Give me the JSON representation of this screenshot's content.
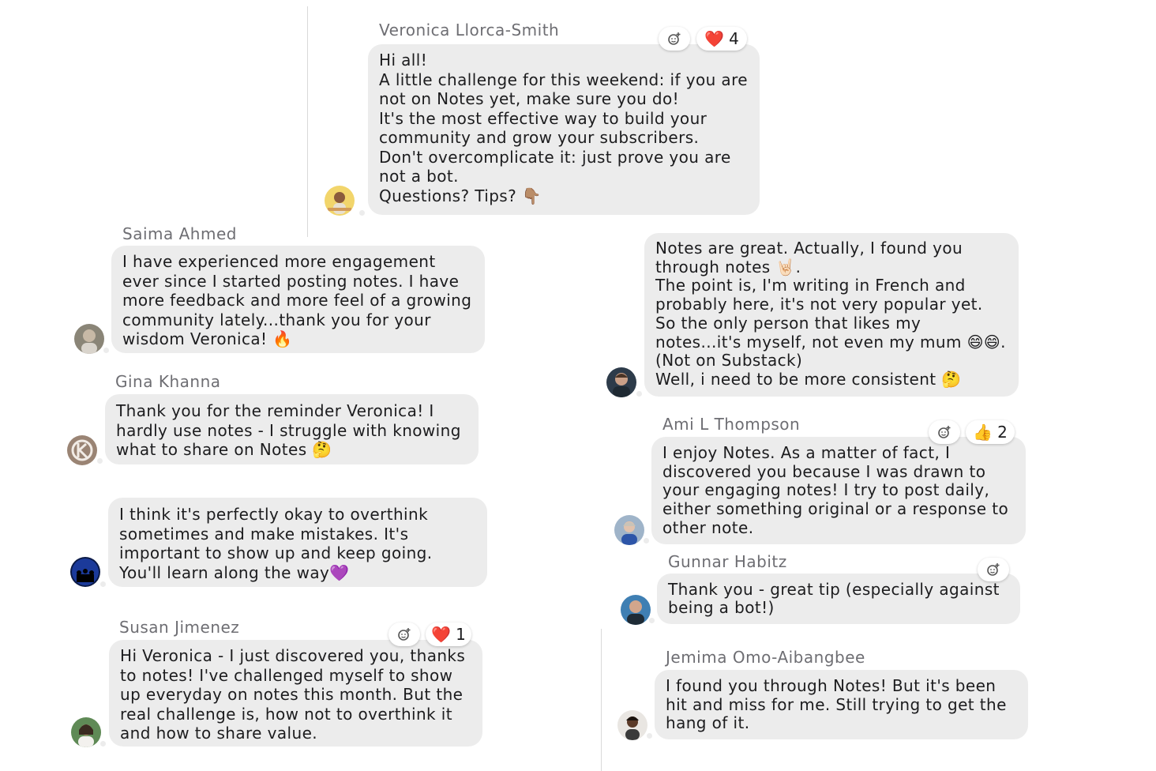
{
  "comments": [
    {
      "author": "Veronica Llorca-Smith",
      "text": "Hi all!\nA little challenge for this weekend: if you are not on Notes yet, make sure you do!\nIt's the most effective way to build your community and grow your subscribers.\nDon't overcomplicate it: just prove you are not a bot.\nQuestions? Tips? 👇🏽",
      "reaction_emoji": "❤️",
      "reaction_count": "4"
    },
    {
      "author": "Saima Ahmed",
      "text": "I have experienced more engagement ever since I started posting notes. I have more feedback and more feel of a growing community lately...thank you for your wisdom Veronica! 🔥"
    },
    {
      "author": "Gina Khanna",
      "text": "Thank you for the reminder Veronica! I hardly use notes - I struggle with knowing what to share on Notes 🤔"
    },
    {
      "author": "",
      "text": "I think it's perfectly okay to overthink sometimes and make mistakes. It's important to show up and keep going. You'll learn along the way💜"
    },
    {
      "author": "Susan Jimenez",
      "text": "Hi Veronica - I just discovered you, thanks to notes! I've challenged myself to show up everyday on notes this month. But the real challenge is, how not to overthink it and how to share value.",
      "reaction_emoji": "❤️",
      "reaction_count": "1"
    },
    {
      "author": "",
      "text": "Notes are great. Actually, I found you through notes 🤘🏻.\nThe point is, I'm writing in French and probably here, it's not very popular yet.\nSo the only person that likes my notes...it's myself, not even my mum 😄😄. (Not on Substack)\nWell, i need to be more consistent 🤔"
    },
    {
      "author": "Ami L Thompson",
      "text": "I enjoy Notes. As a matter of fact, I discovered you because I was drawn to your engaging notes! I try to post daily, either something original or a response to other note.",
      "reaction_emoji": "👍",
      "reaction_count": "2"
    },
    {
      "author": "Gunnar Habitz",
      "text": "Thank you - great tip (especially against being a bot!)"
    },
    {
      "author": "Jemima Omo-Aibangbee",
      "text": "I found you through Notes! But it's been hit and miss for me. Still trying to get the hang of it."
    }
  ],
  "icons": {
    "add_reaction": "add-reaction-icon",
    "avatar": "avatar-icon"
  },
  "colors": {
    "bubble": "#ececec",
    "author": "#6e6e73",
    "text": "#1c1c1e",
    "thread_line": "#d9d9d9"
  }
}
